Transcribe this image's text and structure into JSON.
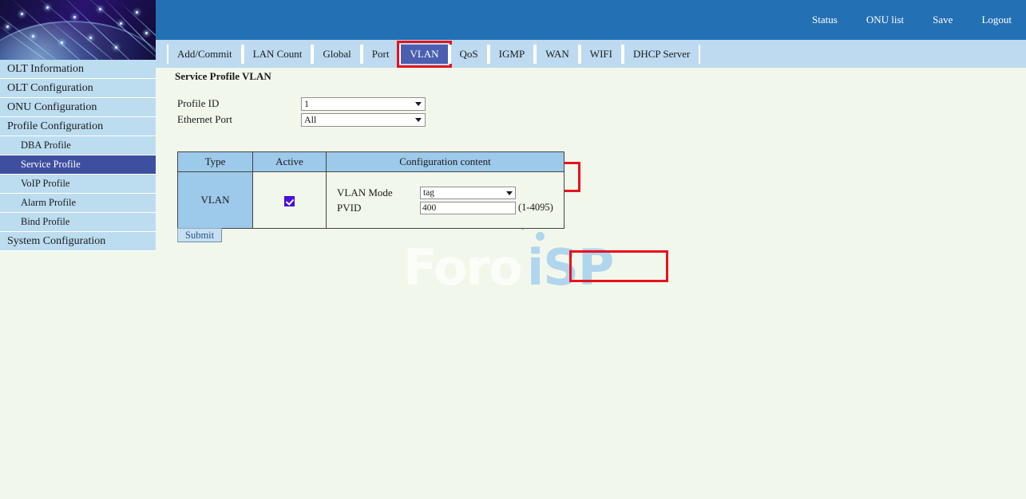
{
  "header": {
    "links": [
      {
        "label": "Status",
        "name": "header-link-status"
      },
      {
        "label": "ONU list",
        "name": "header-link-onu-list"
      },
      {
        "label": "Save",
        "name": "header-link-save"
      },
      {
        "label": "Logout",
        "name": "header-link-logout"
      }
    ],
    "background_color": "#2470b4"
  },
  "banner": {
    "alt": "fiber-optic-globe-banner"
  },
  "sidebar": {
    "items": [
      {
        "label": "OLT Information",
        "level": 0,
        "active": false
      },
      {
        "label": "OLT Configuration",
        "level": 0,
        "active": false
      },
      {
        "label": "ONU Configuration",
        "level": 0,
        "active": false
      },
      {
        "label": "Profile Configuration",
        "level": 0,
        "active": false
      },
      {
        "label": "DBA Profile",
        "level": 1,
        "active": false
      },
      {
        "label": "Service Profile",
        "level": 1,
        "active": true
      },
      {
        "label": "VoIP Profile",
        "level": 1,
        "active": false
      },
      {
        "label": "Alarm Profile",
        "level": 1,
        "active": false
      },
      {
        "label": "Bind Profile",
        "level": 1,
        "active": false
      },
      {
        "label": "System Configuration",
        "level": 0,
        "active": false
      }
    ],
    "active_color": "#3f4fa0",
    "item_color": "#bcdcf0"
  },
  "tabs": [
    {
      "label": "Add/Commit",
      "active": false
    },
    {
      "label": "LAN Count",
      "active": false
    },
    {
      "label": "Global",
      "active": false
    },
    {
      "label": "Port",
      "active": false
    },
    {
      "label": "VLAN",
      "active": true
    },
    {
      "label": "QoS",
      "active": false
    },
    {
      "label": "IGMP",
      "active": false
    },
    {
      "label": "WAN",
      "active": false
    },
    {
      "label": "WIFI",
      "active": false
    },
    {
      "label": "DHCP Server",
      "active": false
    }
  ],
  "main": {
    "page_title": "Service Profile VLAN",
    "form": {
      "profile_id": {
        "label": "Profile ID",
        "value": "1"
      },
      "ethernet_port": {
        "label": "Ethernet Port",
        "value": "All"
      }
    },
    "table": {
      "headers": [
        "Type",
        "Active",
        "Configuration content"
      ],
      "row": {
        "type": "VLAN",
        "active_checked": true,
        "config": {
          "vlan_mode_label": "VLAN Mode",
          "vlan_mode_value": "tag",
          "pvid_label": "PVID",
          "pvid_value": "400",
          "pvid_hint": "(1-4095)"
        }
      }
    },
    "submit_label": "Submit"
  },
  "watermark": {
    "text_light": "Foro",
    "text_blue": "iSP"
  },
  "highlight_color": "#e8121a"
}
